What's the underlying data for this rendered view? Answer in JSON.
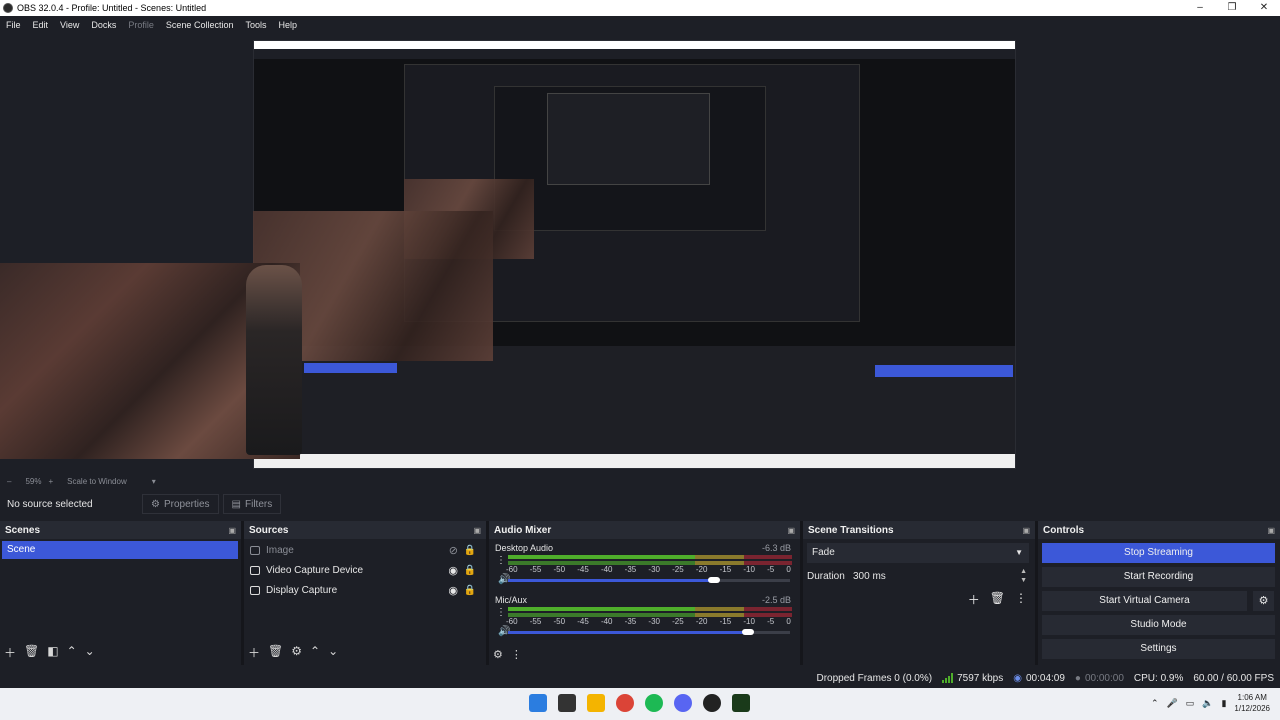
{
  "window": {
    "title": "OBS 32.0.4 - Profile: Untitled - Scenes: Untitled",
    "controls": [
      "–",
      "❐",
      "✕"
    ]
  },
  "menu": {
    "file": "File",
    "edit": "Edit",
    "view": "View",
    "docks": "Docks",
    "profile": "Profile",
    "scene_collection": "Scene Collection",
    "tools": "Tools",
    "help": "Help"
  },
  "preview_footer": {
    "zoom_minus": "–",
    "zoom": "59%",
    "zoom_plus": "+",
    "scale_mode": "Scale to Window"
  },
  "source_toolbar": {
    "status": "No source selected",
    "properties": "Properties",
    "filters": "Filters"
  },
  "docks": {
    "scenes": {
      "title": "Scenes",
      "items": [
        "Scene"
      ]
    },
    "sources": {
      "title": "Sources",
      "items": [
        {
          "name": "Image",
          "icon": "image-icon",
          "visible": false
        },
        {
          "name": "Video Capture Device",
          "icon": "camera-icon",
          "visible": true
        },
        {
          "name": "Display Capture",
          "icon": "monitor-icon",
          "visible": true
        }
      ]
    },
    "mixer": {
      "title": "Audio Mixer",
      "channels": [
        {
          "name": "Desktop Audio",
          "db": "-6.3 dB",
          "volume": 0.73
        },
        {
          "name": "Mic/Aux",
          "db": "-2.5 dB",
          "volume": 0.85
        }
      ],
      "ticks": [
        "-60",
        "-55",
        "-50",
        "-45",
        "-40",
        "-35",
        "-30",
        "-25",
        "-20",
        "-15",
        "-10",
        "-5",
        "0"
      ]
    },
    "transitions": {
      "title": "Scene Transitions",
      "selected": "Fade",
      "duration_label": "Duration",
      "duration_value": "300 ms"
    },
    "controls": {
      "title": "Controls",
      "stop_streaming": "Stop Streaming",
      "start_recording": "Start Recording",
      "start_virtual_camera": "Start Virtual Camera",
      "studio_mode": "Studio Mode",
      "settings": "Settings"
    }
  },
  "status": {
    "dropped_frames": "Dropped Frames 0 (0.0%)",
    "bitrate": "7597 kbps",
    "stream_time": "00:04:09",
    "record_time": "00:00:00",
    "cpu": "CPU: 0.9%",
    "fps": "60.00 / 60.00 FPS"
  },
  "taskbar": {
    "time": "1:06 AM",
    "date": "1/12/2026"
  },
  "colors": {
    "accent": "#3c58d8",
    "background": "#1d1f26",
    "dock_header": "#272a33",
    "meter_green": "#4fae2b",
    "meter_yellow": "#8a7a2c",
    "meter_red": "#7a2430"
  }
}
